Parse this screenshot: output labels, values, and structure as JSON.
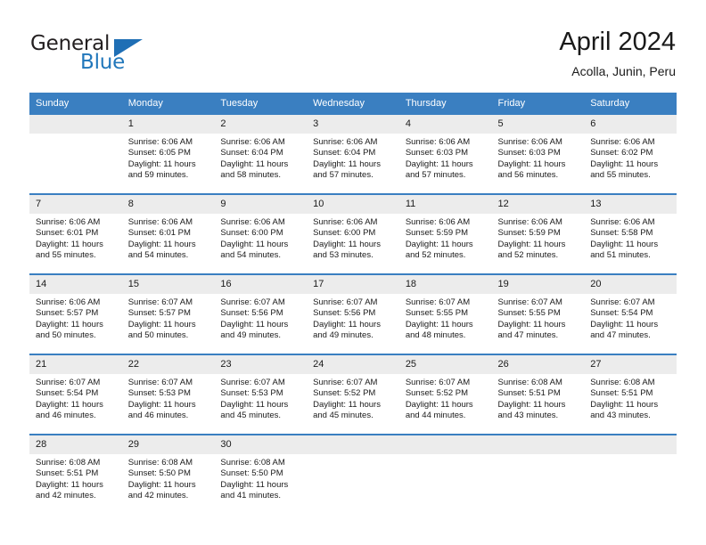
{
  "logo": {
    "word_top": "General",
    "word_bottom": "Blue",
    "accent_color": "#2177bb"
  },
  "header": {
    "title": "April 2024",
    "subtitle": "Acolla, Junin, Peru"
  },
  "theme": {
    "header_bar_color": "#3a7fc1",
    "daynum_band_color": "#ececec",
    "text_color": "#1a1a1a"
  },
  "calendar": {
    "weekday_headers": [
      "Sunday",
      "Monday",
      "Tuesday",
      "Wednesday",
      "Thursday",
      "Friday",
      "Saturday"
    ],
    "weeks": [
      [
        {
          "day": "",
          "empty": true
        },
        {
          "day": "1",
          "sunrise": "Sunrise: 6:06 AM",
          "sunset": "Sunset: 6:05 PM",
          "daylight": "Daylight: 11 hours and 59 minutes."
        },
        {
          "day": "2",
          "sunrise": "Sunrise: 6:06 AM",
          "sunset": "Sunset: 6:04 PM",
          "daylight": "Daylight: 11 hours and 58 minutes."
        },
        {
          "day": "3",
          "sunrise": "Sunrise: 6:06 AM",
          "sunset": "Sunset: 6:04 PM",
          "daylight": "Daylight: 11 hours and 57 minutes."
        },
        {
          "day": "4",
          "sunrise": "Sunrise: 6:06 AM",
          "sunset": "Sunset: 6:03 PM",
          "daylight": "Daylight: 11 hours and 57 minutes."
        },
        {
          "day": "5",
          "sunrise": "Sunrise: 6:06 AM",
          "sunset": "Sunset: 6:03 PM",
          "daylight": "Daylight: 11 hours and 56 minutes."
        },
        {
          "day": "6",
          "sunrise": "Sunrise: 6:06 AM",
          "sunset": "Sunset: 6:02 PM",
          "daylight": "Daylight: 11 hours and 55 minutes."
        }
      ],
      [
        {
          "day": "7",
          "sunrise": "Sunrise: 6:06 AM",
          "sunset": "Sunset: 6:01 PM",
          "daylight": "Daylight: 11 hours and 55 minutes."
        },
        {
          "day": "8",
          "sunrise": "Sunrise: 6:06 AM",
          "sunset": "Sunset: 6:01 PM",
          "daylight": "Daylight: 11 hours and 54 minutes."
        },
        {
          "day": "9",
          "sunrise": "Sunrise: 6:06 AM",
          "sunset": "Sunset: 6:00 PM",
          "daylight": "Daylight: 11 hours and 54 minutes."
        },
        {
          "day": "10",
          "sunrise": "Sunrise: 6:06 AM",
          "sunset": "Sunset: 6:00 PM",
          "daylight": "Daylight: 11 hours and 53 minutes."
        },
        {
          "day": "11",
          "sunrise": "Sunrise: 6:06 AM",
          "sunset": "Sunset: 5:59 PM",
          "daylight": "Daylight: 11 hours and 52 minutes."
        },
        {
          "day": "12",
          "sunrise": "Sunrise: 6:06 AM",
          "sunset": "Sunset: 5:59 PM",
          "daylight": "Daylight: 11 hours and 52 minutes."
        },
        {
          "day": "13",
          "sunrise": "Sunrise: 6:06 AM",
          "sunset": "Sunset: 5:58 PM",
          "daylight": "Daylight: 11 hours and 51 minutes."
        }
      ],
      [
        {
          "day": "14",
          "sunrise": "Sunrise: 6:06 AM",
          "sunset": "Sunset: 5:57 PM",
          "daylight": "Daylight: 11 hours and 50 minutes."
        },
        {
          "day": "15",
          "sunrise": "Sunrise: 6:07 AM",
          "sunset": "Sunset: 5:57 PM",
          "daylight": "Daylight: 11 hours and 50 minutes."
        },
        {
          "day": "16",
          "sunrise": "Sunrise: 6:07 AM",
          "sunset": "Sunset: 5:56 PM",
          "daylight": "Daylight: 11 hours and 49 minutes."
        },
        {
          "day": "17",
          "sunrise": "Sunrise: 6:07 AM",
          "sunset": "Sunset: 5:56 PM",
          "daylight": "Daylight: 11 hours and 49 minutes."
        },
        {
          "day": "18",
          "sunrise": "Sunrise: 6:07 AM",
          "sunset": "Sunset: 5:55 PM",
          "daylight": "Daylight: 11 hours and 48 minutes."
        },
        {
          "day": "19",
          "sunrise": "Sunrise: 6:07 AM",
          "sunset": "Sunset: 5:55 PM",
          "daylight": "Daylight: 11 hours and 47 minutes."
        },
        {
          "day": "20",
          "sunrise": "Sunrise: 6:07 AM",
          "sunset": "Sunset: 5:54 PM",
          "daylight": "Daylight: 11 hours and 47 minutes."
        }
      ],
      [
        {
          "day": "21",
          "sunrise": "Sunrise: 6:07 AM",
          "sunset": "Sunset: 5:54 PM",
          "daylight": "Daylight: 11 hours and 46 minutes."
        },
        {
          "day": "22",
          "sunrise": "Sunrise: 6:07 AM",
          "sunset": "Sunset: 5:53 PM",
          "daylight": "Daylight: 11 hours and 46 minutes."
        },
        {
          "day": "23",
          "sunrise": "Sunrise: 6:07 AM",
          "sunset": "Sunset: 5:53 PM",
          "daylight": "Daylight: 11 hours and 45 minutes."
        },
        {
          "day": "24",
          "sunrise": "Sunrise: 6:07 AM",
          "sunset": "Sunset: 5:52 PM",
          "daylight": "Daylight: 11 hours and 45 minutes."
        },
        {
          "day": "25",
          "sunrise": "Sunrise: 6:07 AM",
          "sunset": "Sunset: 5:52 PM",
          "daylight": "Daylight: 11 hours and 44 minutes."
        },
        {
          "day": "26",
          "sunrise": "Sunrise: 6:08 AM",
          "sunset": "Sunset: 5:51 PM",
          "daylight": "Daylight: 11 hours and 43 minutes."
        },
        {
          "day": "27",
          "sunrise": "Sunrise: 6:08 AM",
          "sunset": "Sunset: 5:51 PM",
          "daylight": "Daylight: 11 hours and 43 minutes."
        }
      ],
      [
        {
          "day": "28",
          "sunrise": "Sunrise: 6:08 AM",
          "sunset": "Sunset: 5:51 PM",
          "daylight": "Daylight: 11 hours and 42 minutes."
        },
        {
          "day": "29",
          "sunrise": "Sunrise: 6:08 AM",
          "sunset": "Sunset: 5:50 PM",
          "daylight": "Daylight: 11 hours and 42 minutes."
        },
        {
          "day": "30",
          "sunrise": "Sunrise: 6:08 AM",
          "sunset": "Sunset: 5:50 PM",
          "daylight": "Daylight: 11 hours and 41 minutes."
        },
        {
          "day": "",
          "empty": true
        },
        {
          "day": "",
          "empty": true
        },
        {
          "day": "",
          "empty": true
        },
        {
          "day": "",
          "empty": true
        }
      ]
    ]
  }
}
